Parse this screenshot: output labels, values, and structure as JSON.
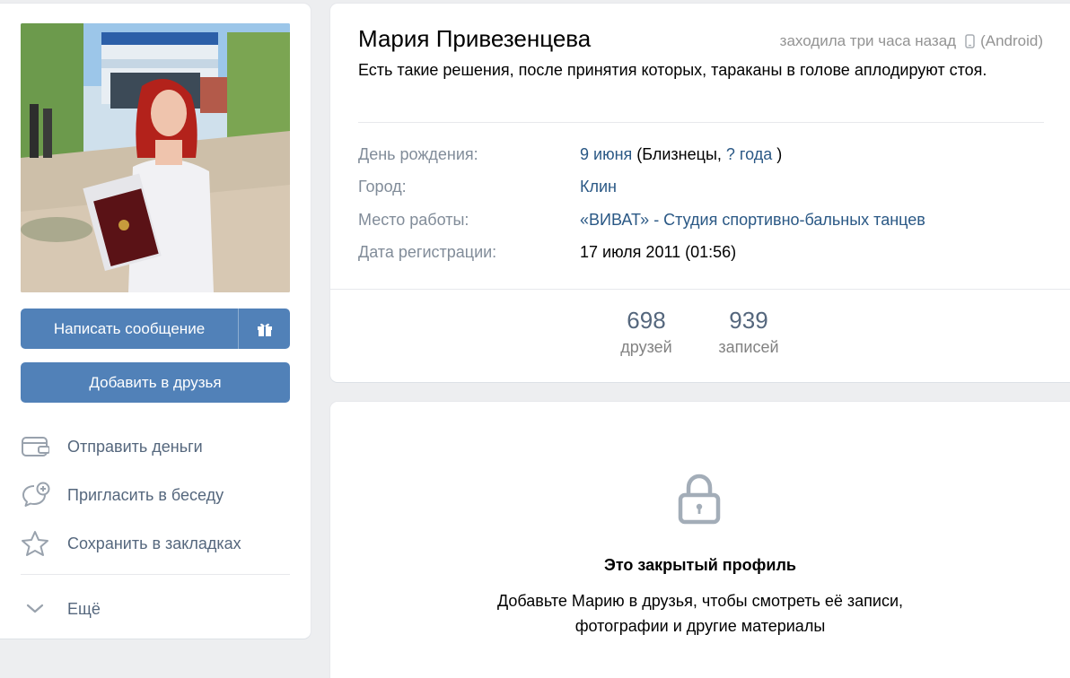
{
  "profile": {
    "name": "Мария Привезенцева",
    "last_seen": "заходила три часа назад",
    "device": "(Android)",
    "status": "Есть такие решения, после принятия которых, тараканы в голове аплодируют стоя."
  },
  "actions": {
    "message": "Написать сообщение",
    "add_friend": "Добавить в друзья",
    "send_money": "Отправить деньги",
    "invite_chat": "Пригласить в беседу",
    "bookmark": "Сохранить в закладках",
    "more": "Ещё"
  },
  "details": {
    "birthday_label": "День рождения:",
    "birthday_date": "9 июня",
    "birthday_open": " (Близнецы, ",
    "birthday_age": "? года",
    "birthday_close": " )",
    "city_label": "Город:",
    "city": "Клин",
    "work_label": "Место работы:",
    "work_link": "«ВИВАТ»",
    "work_rest": " - Студия спортивно-бальных танцев",
    "reg_label": "Дата регистрации:",
    "reg_date": "17 июля 2011 (01:56)"
  },
  "counters": [
    {
      "value": "698",
      "label": "друзей"
    },
    {
      "value": "939",
      "label": "записей"
    }
  ],
  "closed": {
    "title": "Это закрытый профиль",
    "line1": "Добавьте Марию в друзья, чтобы смотреть её записи,",
    "line2": "фотографии и другие материалы"
  },
  "colors": {
    "accent": "#5181b8",
    "link": "#2a5885",
    "muted": "#818c99"
  },
  "icons": {
    "gift": "gift-icon",
    "money": "wallet-icon",
    "chat": "chat-add-icon",
    "bookmark": "star-icon",
    "more": "chevron-down-icon",
    "lock": "lock-icon",
    "device": "phone-icon"
  }
}
